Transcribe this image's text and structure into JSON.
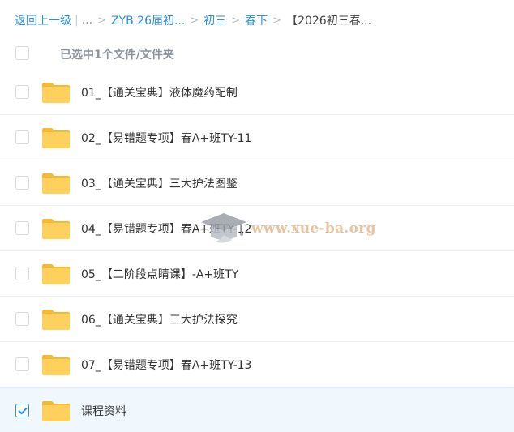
{
  "breadcrumb": {
    "back_label": "返回上一级",
    "pipe": "|",
    "ellipsis": "...",
    "sep": ">",
    "items": [
      "ZYB 26届初...",
      "初三",
      "春下"
    ],
    "current": "【2026初三春..."
  },
  "header": {
    "selection_text": "已选中1个文件/文件夹"
  },
  "files": [
    {
      "name": "01_【通关宝典】液体魔药配制",
      "selected": false
    },
    {
      "name": "02_【易错题专项】春A+班TY-11",
      "selected": false
    },
    {
      "name": "03_【通关宝典】三大护法图鉴",
      "selected": false
    },
    {
      "name": "04_【易错题专项】春A+班TY-12",
      "selected": false
    },
    {
      "name": "05_【二阶段点睛课】-A+班TY",
      "selected": false
    },
    {
      "name": "06_【通关宝典】三大护法探究",
      "selected": false
    },
    {
      "name": "07_【易错题专项】春A+班TY-13",
      "selected": false
    },
    {
      "name": "课程资料",
      "selected": true
    }
  ],
  "watermark": {
    "text": "www.xue-ba.org",
    "icon": "graduation-cap-icon"
  },
  "colors": {
    "accent": "#2c8fe0",
    "folder": "#ffd05b",
    "folder_tab": "#f5b932",
    "selected_row": "#f0f7fd"
  }
}
